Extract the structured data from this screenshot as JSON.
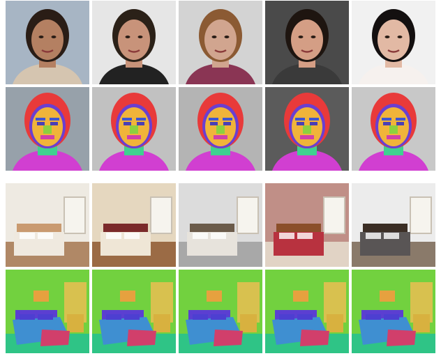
{
  "figure": {
    "groups": [
      {
        "name": "faces",
        "photos": [
          {
            "bg": "#a7b5c4",
            "skin": "#b48062",
            "hair": "#2a1d16",
            "cloth": "#d5c5b0"
          },
          {
            "bg": "#e6e6e6",
            "skin": "#c8937a",
            "hair": "#2b2118",
            "cloth": "#222222"
          },
          {
            "bg": "#d3d3d3",
            "skin": "#d1a58f",
            "hair": "#8b5a33",
            "cloth": "#8a3554"
          },
          {
            "bg": "#4a4a4a",
            "skin": "#d49e85",
            "hair": "#1e1510",
            "cloth": "#3a3a3a"
          },
          {
            "bg": "#f1f1f1",
            "skin": "#e2b9a4",
            "hair": "#141010",
            "cloth": "#f6f1ee"
          }
        ],
        "segmentation_palette": {
          "hair": "#e83a3a",
          "skin": "#f0b43a",
          "brow": "#3f56d1",
          "eye": "#4a3fb5",
          "nose": "#8cd13f",
          "mouth": "#d13fa8",
          "neck": "#3fd190",
          "cloth": "#d13fd1",
          "outline": "#6a3fd1",
          "background_tint": "#7a7a7a"
        }
      },
      {
        "name": "bedrooms",
        "photos": [
          {
            "wall": "#eeeae2",
            "floor": "#b08866",
            "bed": "#efe9df",
            "accent": "#c99a70"
          },
          {
            "wall": "#e5d7bf",
            "floor": "#9b6b45",
            "bed": "#efe6d6",
            "accent": "#7b2a2a"
          },
          {
            "wall": "#dcdcdc",
            "floor": "#a8a8a8",
            "bed": "#e7e3dc",
            "accent": "#6b5b4a"
          },
          {
            "wall": "#c08f87",
            "floor": "#e1d3c5",
            "bed": "#b8323f",
            "accent": "#8b4f2a"
          },
          {
            "wall": "#ececec",
            "floor": "#8a7a6a",
            "bed": "#595555",
            "accent": "#3b2e25"
          }
        ],
        "segmentation_palette": {
          "wall": "#72d13f",
          "floor": "#2fc486",
          "bed": "#3f8fd1",
          "pillow": "#4d3fd1",
          "blanket_edge": "#d13f6b",
          "furniture": "#d8b13f",
          "window": "#d8c14f",
          "headboard": "#5b3fd1",
          "picture": "#e6a13f"
        }
      }
    ]
  }
}
